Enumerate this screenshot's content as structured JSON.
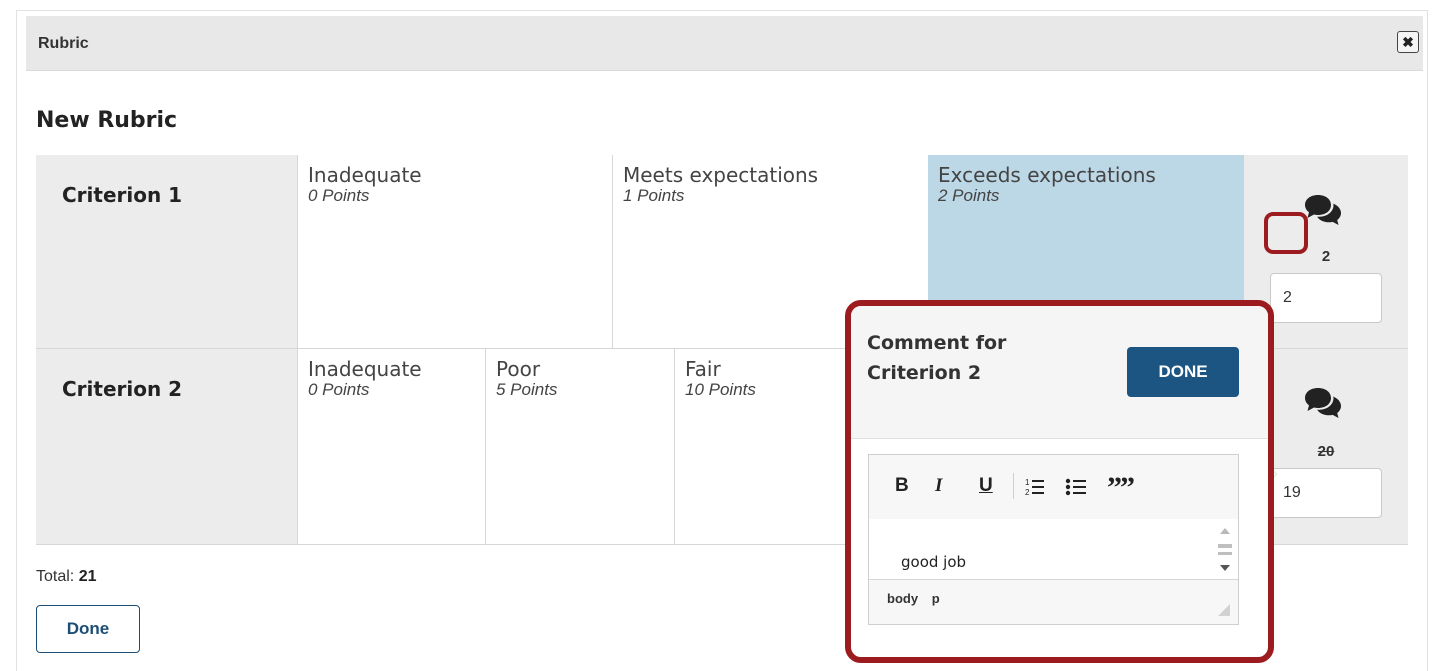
{
  "dialog": {
    "title": "Rubric",
    "close_icon": "close-icon"
  },
  "rubric": {
    "title": "New Rubric",
    "criteria": [
      {
        "name": "Criterion 1",
        "levels": [
          {
            "label": "Inadequate",
            "points": "0 Points"
          },
          {
            "label": "Meets expectations",
            "points": "1 Points"
          },
          {
            "label": "Exceeds expectations",
            "points": "2 Points",
            "selected": true
          }
        ],
        "score_label": "2",
        "score_value": "2",
        "comment_icon": "comment-icon"
      },
      {
        "name": "Criterion 2",
        "levels": [
          {
            "label": "Inadequate",
            "points": "0 Points"
          },
          {
            "label": "Poor",
            "points": "5 Points"
          },
          {
            "label": "Fair",
            "points": "10 Points"
          }
        ],
        "score_label": "20",
        "score_value": "19",
        "comment_icon": "comment-icon"
      }
    ]
  },
  "footer": {
    "total_label": "Total:",
    "total_value": "21",
    "done_label": "Done"
  },
  "comment_popup": {
    "title": "Comment for Criterion 2",
    "done_label": "DONE",
    "toolbar": {
      "bold": "B",
      "italic": "I",
      "underline": "U",
      "numbered_list_icon": "numbered-list-icon",
      "bulleted_list_icon": "bulleted-list-icon",
      "blockquote": "”"
    },
    "content": "good job",
    "status_path": [
      "body",
      "p"
    ]
  },
  "colors": {
    "selected_cell": "#bcd7e6",
    "primary": "#1d5582",
    "highlight": "#9b1b1f"
  }
}
